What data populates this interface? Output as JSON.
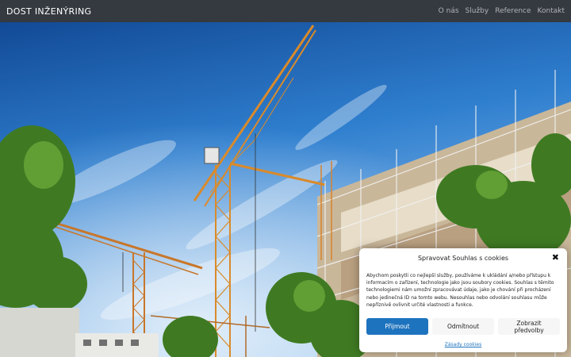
{
  "navbar": {
    "brand": "DOST INŽENÝRING",
    "links": [
      "O nás",
      "Služby",
      "Reference",
      "Kontakt"
    ]
  },
  "hero": {
    "description": ""
  },
  "cookie_dialog": {
    "title": "Spravovat Souhlas s cookies",
    "text": "Abychom poskytli co nejlepší služby, používáme k ukládání a/nebo přístupu k informacím o zařízení, technologie jako jsou soubory cookies. Souhlas s těmito technologiemi nám umožní zpracovávat údaje, jako je chování při procházení nebo jedinečná ID na tomto webu. Nesouhlas nebo odvolání souhlasu může nepříznivě ovlivnit určité vlastnosti a funkce.",
    "accept_label": "Přijmout",
    "deny_label": "Odmítnout",
    "prefs_label": "Zobrazit předvolby",
    "policy_label": "Zásady cookies",
    "accent_color": "#1e73be"
  }
}
